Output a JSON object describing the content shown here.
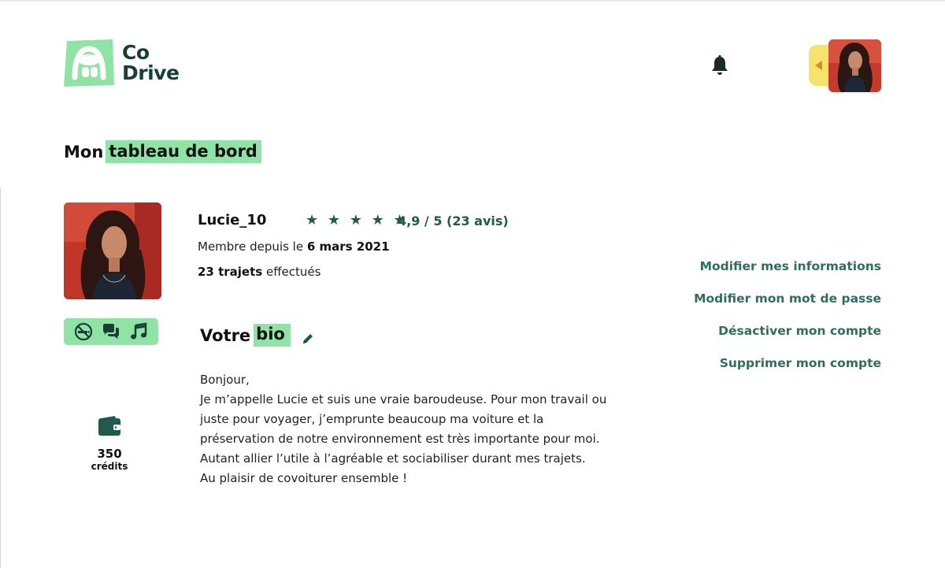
{
  "brand": {
    "line1": "Co",
    "line2": "Drive"
  },
  "header": {
    "bell_icon": "bell-icon",
    "avatar_icon": "user-avatar"
  },
  "title": {
    "prefix": "Mon",
    "highlight": "tableau de bord"
  },
  "profile": {
    "username": "Lucie_10",
    "stars": "★ ★ ★ ★ ★",
    "rating": "4,9 / 5 (23 avis)",
    "member_prefix": "Membre depuis le",
    "member_date": "6 mars 2021",
    "trips_bold": "23 trajets",
    "trips_suffix": "effectués"
  },
  "preferences": [
    "no-smoking-icon",
    "chat-icon",
    "music-icon"
  ],
  "wallet": {
    "amount": "350",
    "label": "crédits"
  },
  "bio": {
    "title_prefix": "Votre",
    "title_highlight": "bio",
    "lines": [
      "Bonjour,",
      "Je m’appelle Lucie et suis une vraie baroudeuse. Pour mon travail ou juste pour voyager, j’emprunte beaucoup ma voiture et la préservation de notre environnement est très importante pour moi. Autant allier l’utile à l’agréable et sociabiliser durant mes trajets.",
      "Au plaisir de covoiturer ensemble !"
    ]
  },
  "actions": {
    "edit_info": "Modifier mes informations",
    "edit_password": "Modifier mon mot de passe",
    "deactivate": "Désactiver mon compte",
    "delete": "Supprimer mon compte"
  },
  "colors": {
    "accent": "#8ee3a5",
    "primary": "#1f5a4c",
    "link": "#2f6e5d",
    "chip": "#f6e36c"
  }
}
